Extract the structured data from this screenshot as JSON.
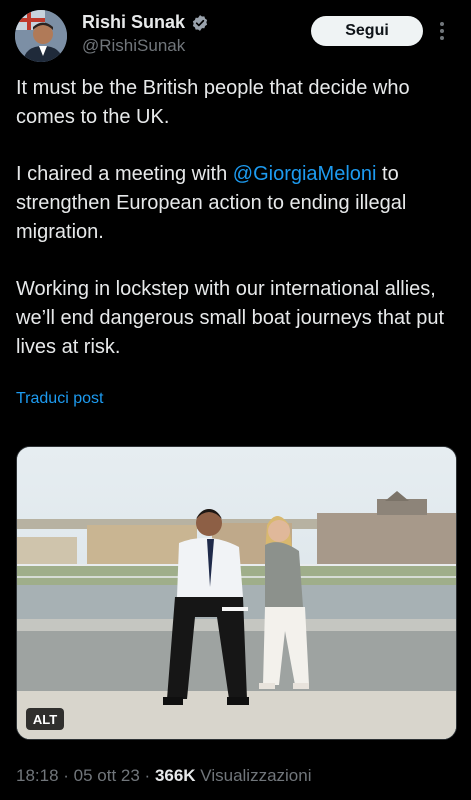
{
  "author": {
    "display_name": "Rishi Sunak",
    "handle": "@RishiSunak",
    "verified_icon": "verified-badge-icon"
  },
  "actions": {
    "follow_label": "Segui",
    "more_icon": "more-vertical-icon"
  },
  "tweet": {
    "para1": "It must be the British people that decide who comes to the UK.",
    "para2_prefix": "I chaired a meeting with ",
    "para2_mention": "@GiorgiaMeloni",
    "para2_suffix": " to strengthen European action to ending illegal migration.",
    "para3": "Working in lockstep with our international allies, we’ll end dangerous small boat journeys that put lives at risk."
  },
  "translate_label": "Traduci post",
  "media": {
    "alt_label": "ALT"
  },
  "meta": {
    "time": "18:18",
    "sep1": " · ",
    "date": "05 ott 23",
    "sep2": " · ",
    "views_count": "366K",
    "views_label": " Visualizzazioni"
  },
  "colors": {
    "background": "#000000",
    "text": "#e7e9ea",
    "secondary": "#71767b",
    "link": "#1d9bf0"
  }
}
